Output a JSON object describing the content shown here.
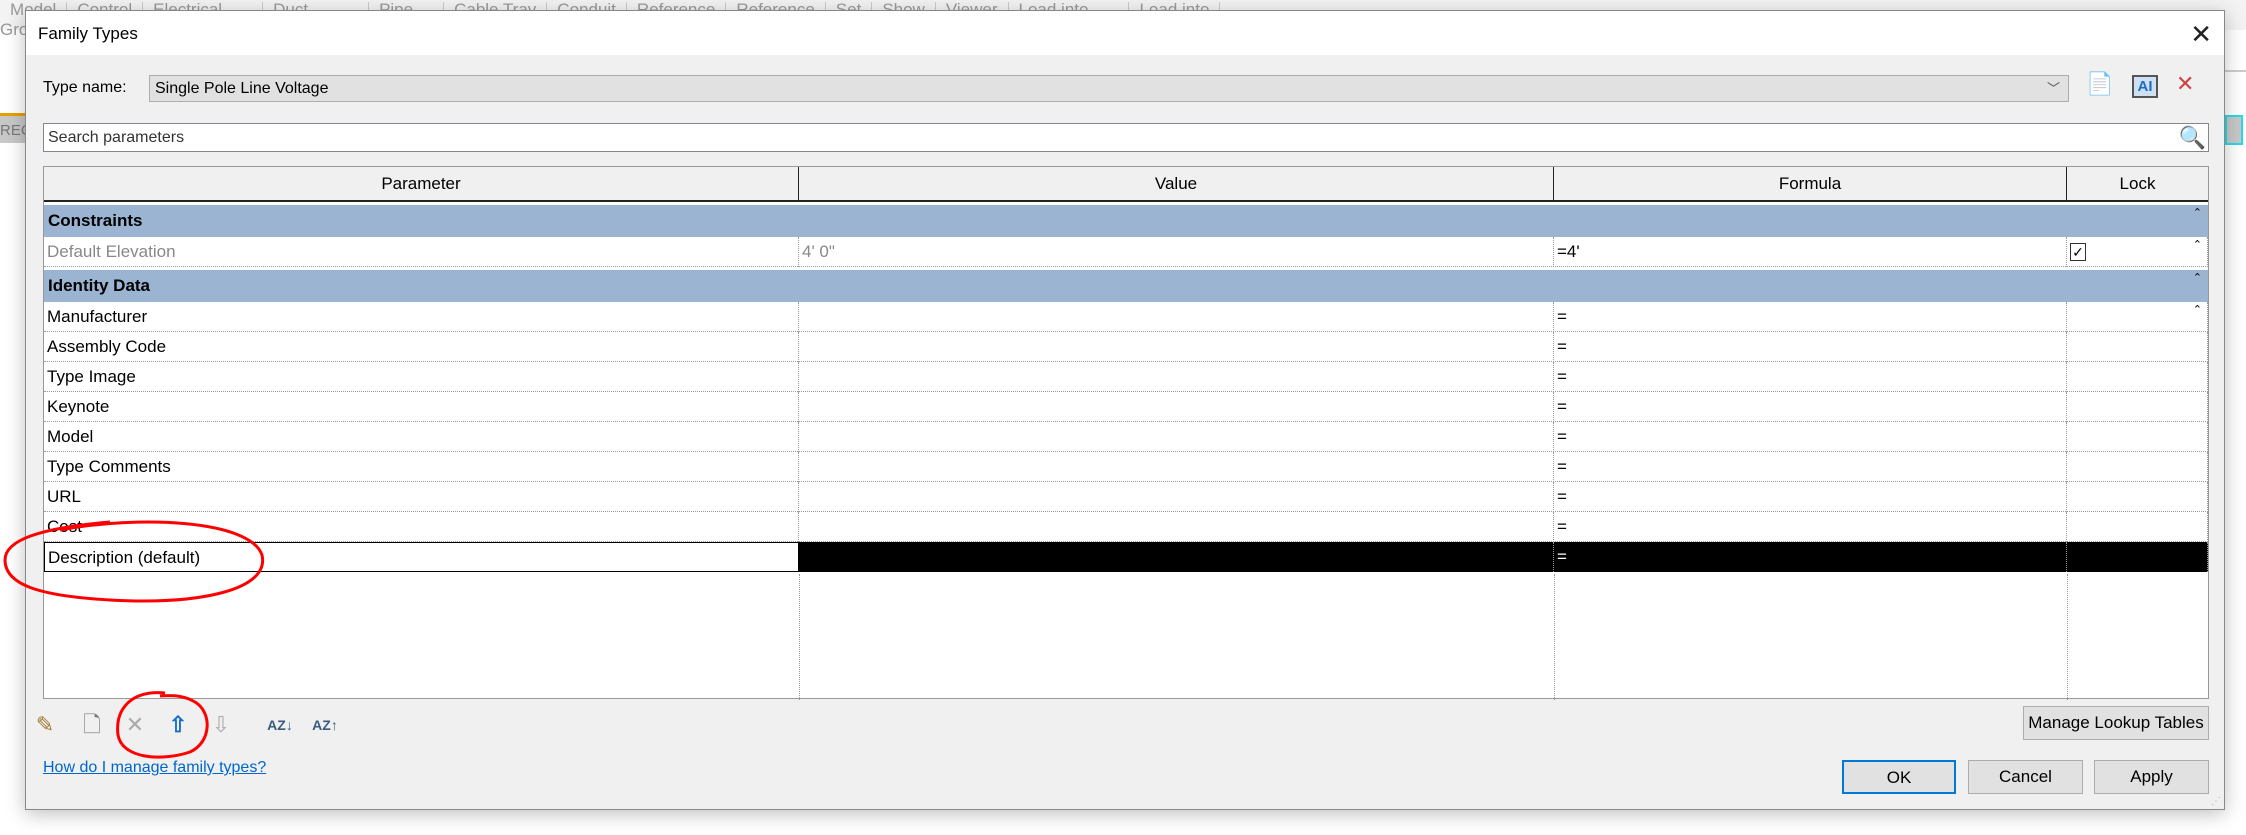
{
  "background": {
    "ribbon": [
      "Model",
      "Control",
      "Electrical",
      "Duct",
      "Pipe",
      "Cable Tray",
      "Conduit",
      "Reference",
      "Reference",
      "Set",
      "Show",
      "Viewer",
      "Load into",
      "Load into"
    ],
    "left_text": "Gro",
    "left_tab": "REC"
  },
  "dialog": {
    "title": "Family Types",
    "close_icon": "close-icon",
    "type_name_label": "Type name:",
    "type_name_value": "Single Pole Line Voltage",
    "search_placeholder": "Search parameters",
    "columns": [
      "Parameter",
      "Value",
      "Formula",
      "Lock"
    ],
    "groups": [
      {
        "name": "Constraints",
        "rows": [
          {
            "parameter": "Default Elevation",
            "value": "4'  0\"",
            "formula": "=4'",
            "lock": true
          }
        ]
      },
      {
        "name": "Identity Data",
        "rows": [
          {
            "parameter": "Manufacturer",
            "value": "",
            "formula": "="
          },
          {
            "parameter": "Assembly Code",
            "value": "",
            "formula": "="
          },
          {
            "parameter": "Type Image",
            "value": "",
            "formula": "="
          },
          {
            "parameter": "Keynote",
            "value": "",
            "formula": "="
          },
          {
            "parameter": "Model",
            "value": "",
            "formula": "="
          },
          {
            "parameter": "Type Comments",
            "value": "",
            "formula": "="
          },
          {
            "parameter": "URL",
            "value": "",
            "formula": "="
          },
          {
            "parameter": "Cost",
            "value": "",
            "formula": "="
          },
          {
            "parameter": "Description (default)",
            "value": "",
            "formula": "=",
            "selected": true
          }
        ]
      }
    ],
    "help_link": "How do I manage family types?",
    "manage_lookup": "Manage Lookup Tables",
    "ok": "OK",
    "cancel": "Cancel",
    "apply": "Apply",
    "annotation_color": "#ff0000",
    "header_color": "#9ab4d1",
    "accent": "#0078d7"
  }
}
